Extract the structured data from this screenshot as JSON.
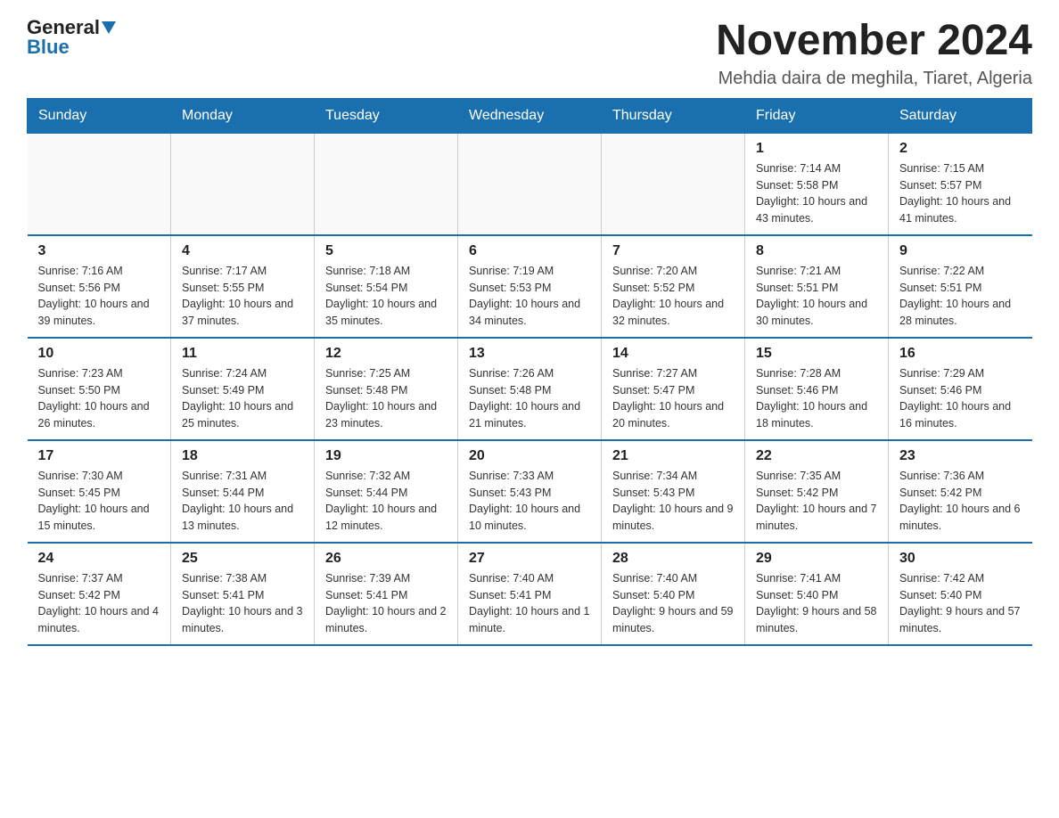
{
  "logo": {
    "general": "General",
    "blue": "Blue"
  },
  "title": "November 2024",
  "subtitle": "Mehdia daira de meghila, Tiaret, Algeria",
  "weekdays": [
    "Sunday",
    "Monday",
    "Tuesday",
    "Wednesday",
    "Thursday",
    "Friday",
    "Saturday"
  ],
  "weeks": [
    [
      {
        "day": "",
        "info": ""
      },
      {
        "day": "",
        "info": ""
      },
      {
        "day": "",
        "info": ""
      },
      {
        "day": "",
        "info": ""
      },
      {
        "day": "",
        "info": ""
      },
      {
        "day": "1",
        "info": "Sunrise: 7:14 AM\nSunset: 5:58 PM\nDaylight: 10 hours and 43 minutes."
      },
      {
        "day": "2",
        "info": "Sunrise: 7:15 AM\nSunset: 5:57 PM\nDaylight: 10 hours and 41 minutes."
      }
    ],
    [
      {
        "day": "3",
        "info": "Sunrise: 7:16 AM\nSunset: 5:56 PM\nDaylight: 10 hours and 39 minutes."
      },
      {
        "day": "4",
        "info": "Sunrise: 7:17 AM\nSunset: 5:55 PM\nDaylight: 10 hours and 37 minutes."
      },
      {
        "day": "5",
        "info": "Sunrise: 7:18 AM\nSunset: 5:54 PM\nDaylight: 10 hours and 35 minutes."
      },
      {
        "day": "6",
        "info": "Sunrise: 7:19 AM\nSunset: 5:53 PM\nDaylight: 10 hours and 34 minutes."
      },
      {
        "day": "7",
        "info": "Sunrise: 7:20 AM\nSunset: 5:52 PM\nDaylight: 10 hours and 32 minutes."
      },
      {
        "day": "8",
        "info": "Sunrise: 7:21 AM\nSunset: 5:51 PM\nDaylight: 10 hours and 30 minutes."
      },
      {
        "day": "9",
        "info": "Sunrise: 7:22 AM\nSunset: 5:51 PM\nDaylight: 10 hours and 28 minutes."
      }
    ],
    [
      {
        "day": "10",
        "info": "Sunrise: 7:23 AM\nSunset: 5:50 PM\nDaylight: 10 hours and 26 minutes."
      },
      {
        "day": "11",
        "info": "Sunrise: 7:24 AM\nSunset: 5:49 PM\nDaylight: 10 hours and 25 minutes."
      },
      {
        "day": "12",
        "info": "Sunrise: 7:25 AM\nSunset: 5:48 PM\nDaylight: 10 hours and 23 minutes."
      },
      {
        "day": "13",
        "info": "Sunrise: 7:26 AM\nSunset: 5:48 PM\nDaylight: 10 hours and 21 minutes."
      },
      {
        "day": "14",
        "info": "Sunrise: 7:27 AM\nSunset: 5:47 PM\nDaylight: 10 hours and 20 minutes."
      },
      {
        "day": "15",
        "info": "Sunrise: 7:28 AM\nSunset: 5:46 PM\nDaylight: 10 hours and 18 minutes."
      },
      {
        "day": "16",
        "info": "Sunrise: 7:29 AM\nSunset: 5:46 PM\nDaylight: 10 hours and 16 minutes."
      }
    ],
    [
      {
        "day": "17",
        "info": "Sunrise: 7:30 AM\nSunset: 5:45 PM\nDaylight: 10 hours and 15 minutes."
      },
      {
        "day": "18",
        "info": "Sunrise: 7:31 AM\nSunset: 5:44 PM\nDaylight: 10 hours and 13 minutes."
      },
      {
        "day": "19",
        "info": "Sunrise: 7:32 AM\nSunset: 5:44 PM\nDaylight: 10 hours and 12 minutes."
      },
      {
        "day": "20",
        "info": "Sunrise: 7:33 AM\nSunset: 5:43 PM\nDaylight: 10 hours and 10 minutes."
      },
      {
        "day": "21",
        "info": "Sunrise: 7:34 AM\nSunset: 5:43 PM\nDaylight: 10 hours and 9 minutes."
      },
      {
        "day": "22",
        "info": "Sunrise: 7:35 AM\nSunset: 5:42 PM\nDaylight: 10 hours and 7 minutes."
      },
      {
        "day": "23",
        "info": "Sunrise: 7:36 AM\nSunset: 5:42 PM\nDaylight: 10 hours and 6 minutes."
      }
    ],
    [
      {
        "day": "24",
        "info": "Sunrise: 7:37 AM\nSunset: 5:42 PM\nDaylight: 10 hours and 4 minutes."
      },
      {
        "day": "25",
        "info": "Sunrise: 7:38 AM\nSunset: 5:41 PM\nDaylight: 10 hours and 3 minutes."
      },
      {
        "day": "26",
        "info": "Sunrise: 7:39 AM\nSunset: 5:41 PM\nDaylight: 10 hours and 2 minutes."
      },
      {
        "day": "27",
        "info": "Sunrise: 7:40 AM\nSunset: 5:41 PM\nDaylight: 10 hours and 1 minute."
      },
      {
        "day": "28",
        "info": "Sunrise: 7:40 AM\nSunset: 5:40 PM\nDaylight: 9 hours and 59 minutes."
      },
      {
        "day": "29",
        "info": "Sunrise: 7:41 AM\nSunset: 5:40 PM\nDaylight: 9 hours and 58 minutes."
      },
      {
        "day": "30",
        "info": "Sunrise: 7:42 AM\nSunset: 5:40 PM\nDaylight: 9 hours and 57 minutes."
      }
    ]
  ]
}
